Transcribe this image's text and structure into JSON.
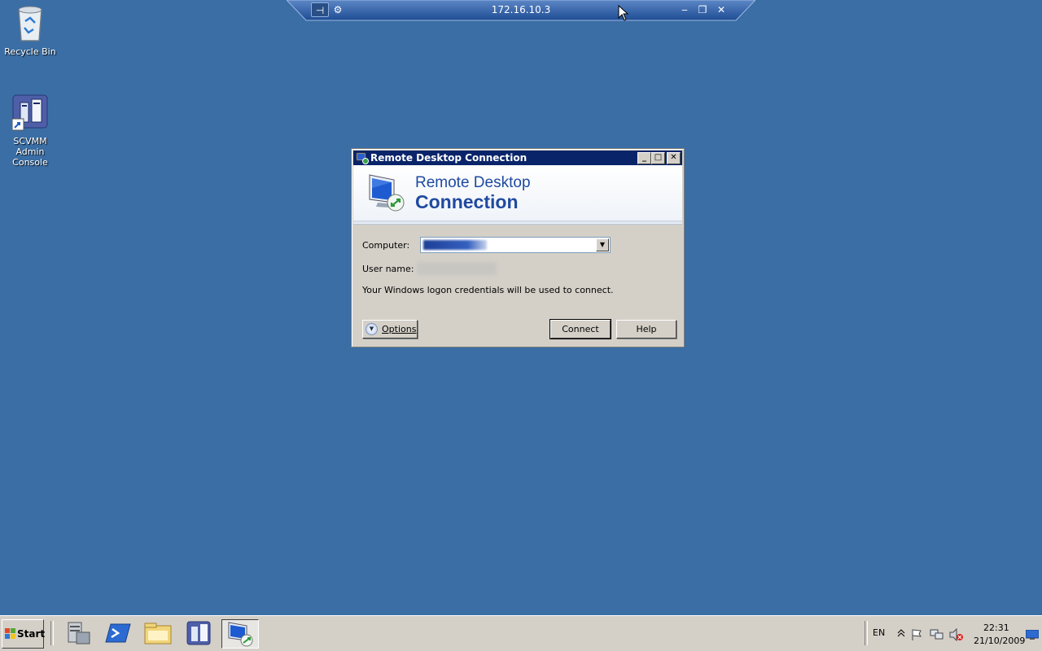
{
  "desktop": {
    "icons": [
      {
        "label": "Recycle Bin"
      },
      {
        "label": "SCVMM Admin Console"
      }
    ]
  },
  "rdp_bar": {
    "host": "172.16.10.3",
    "pin_symbol": "⊣",
    "tools_symbol": "⚙",
    "minimize_symbol": "‒",
    "restore_symbol": "❐",
    "close_symbol": "✕"
  },
  "dialog": {
    "title": "Remote Desktop Connection",
    "banner_line1": "Remote Desktop",
    "banner_line2": "Connection",
    "computer_label": "Computer:",
    "username_label": "User name:",
    "info_text": "Your Windows logon credentials will be used to connect.",
    "options_label": "Options",
    "connect_label": "Connect",
    "help_label": "Help",
    "title_buttons": {
      "minimize": "_",
      "maximize": "□",
      "close": "✕"
    }
  },
  "taskbar": {
    "start_label": "Start",
    "language": "EN",
    "time": "22:31",
    "date": "21/10/2009",
    "pinned": [
      "server-manager-icon",
      "powershell-icon",
      "explorer-icon",
      "scvmm-icon",
      "remote-desktop-icon"
    ]
  },
  "colors": {
    "desktop": "#3a6ea5",
    "titlebar": "#0a246a",
    "banner_text": "#1f4aa0"
  }
}
